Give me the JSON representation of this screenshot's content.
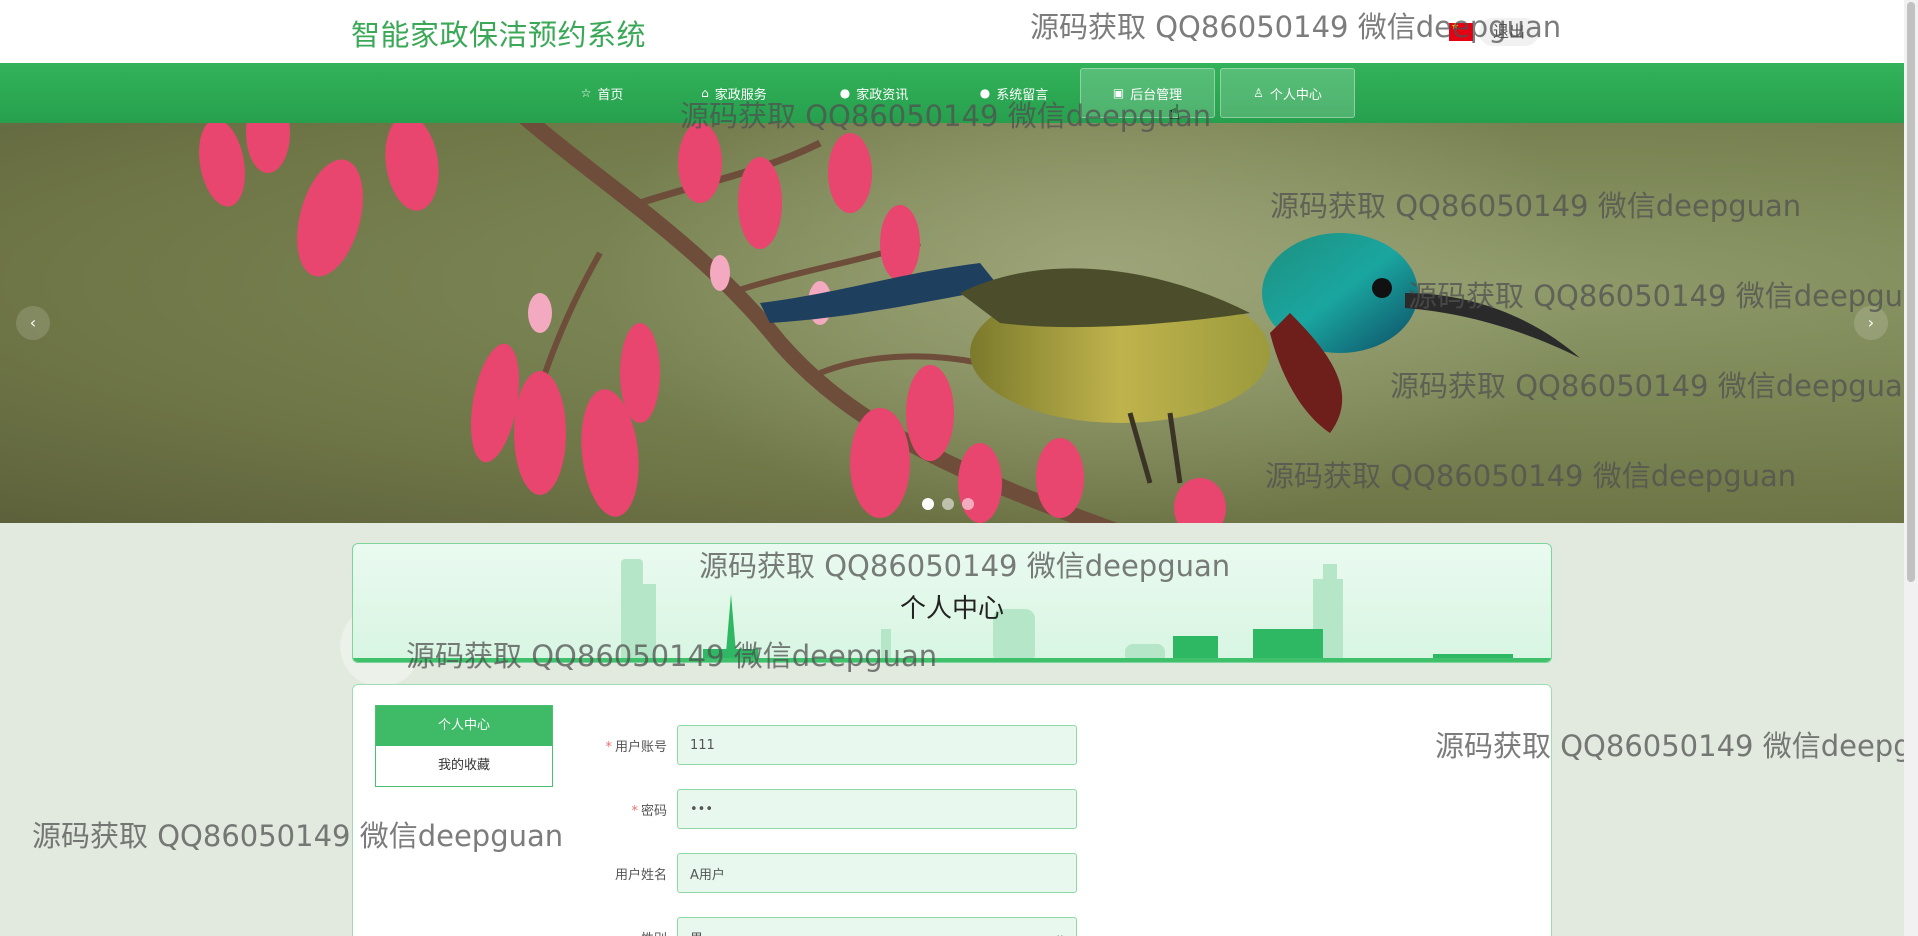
{
  "header": {
    "site_title": "智能家政保洁预约系统",
    "logout_label": "退出"
  },
  "nav": {
    "items": [
      {
        "label": "首页",
        "icon": "star-icon"
      },
      {
        "label": "家政服务",
        "icon": "bag-icon"
      },
      {
        "label": "家政资讯",
        "icon": "info-icon"
      },
      {
        "label": "系统留言",
        "icon": "message-icon"
      },
      {
        "label": "后台管理",
        "icon": "dashboard-icon"
      },
      {
        "label": "个人中心",
        "icon": "user-icon"
      }
    ]
  },
  "carousel": {
    "prev": "‹",
    "next": "›",
    "slide_count": 3,
    "active_index": 0
  },
  "section_title": "个人中心",
  "side_menu": {
    "items": [
      "个人中心",
      "我的收藏"
    ],
    "active": "个人中心"
  },
  "form": {
    "account_label": "用户账号",
    "account_value": "111",
    "password_label": "密码",
    "password_value": "•••",
    "name_label": "用户姓名",
    "name_value": "A用户",
    "gender_label": "性别",
    "gender_value": "男"
  },
  "watermark": "源码获取 QQ86050149 微信deepguan",
  "colors": {
    "primary": "#32b25a",
    "title_green": "#3aa856"
  }
}
